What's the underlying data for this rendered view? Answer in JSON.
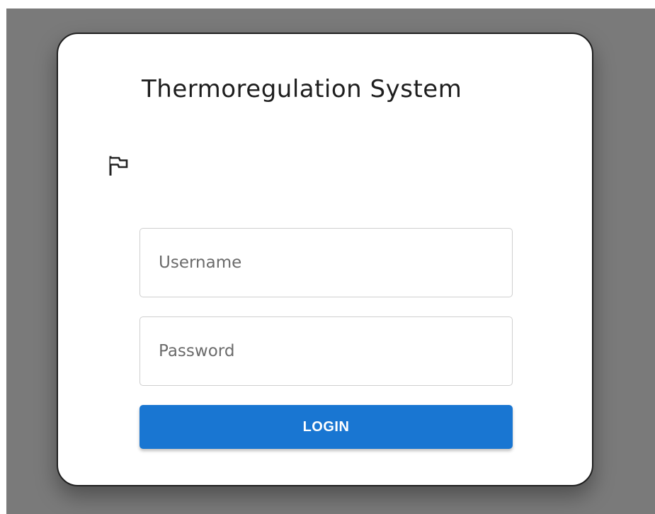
{
  "app": {
    "title": "Thermoregulation System"
  },
  "icons": {
    "language": "flag-icon"
  },
  "form": {
    "username": {
      "placeholder": "Username",
      "value": ""
    },
    "password": {
      "placeholder": "Password",
      "value": ""
    },
    "login_label": "LOGIN"
  },
  "colors": {
    "backdrop": "#7a7a7a",
    "card": "#ffffff",
    "primary_button": "#1976d2"
  }
}
